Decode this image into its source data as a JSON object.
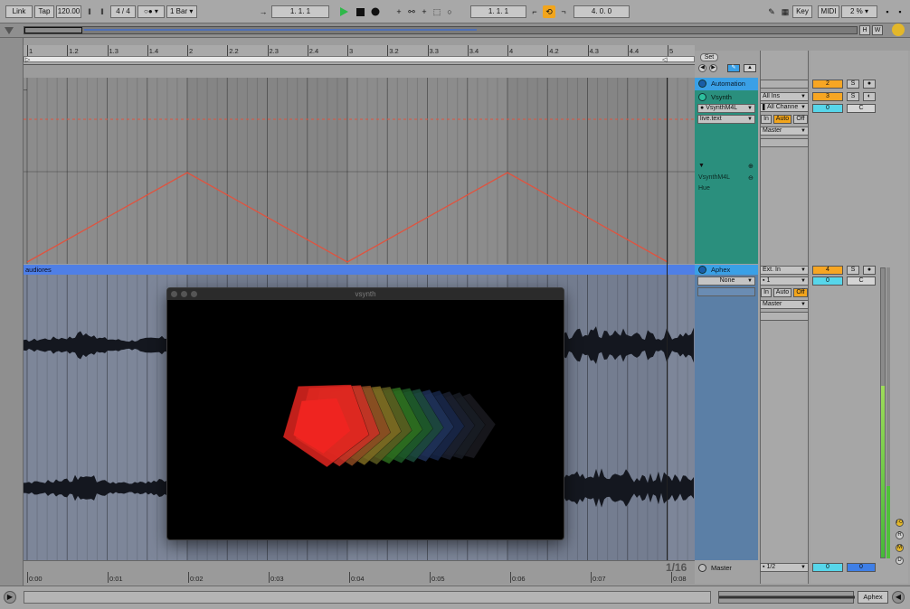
{
  "transport": {
    "link": "Link",
    "tap": "Tap",
    "tempo": "120.00",
    "time_signature": "4 / 4",
    "quantize": "1 Bar",
    "arrangement_position": "1.   1.   1",
    "loop_start": "1.   1.   1",
    "loop_length": "4.   0.   0",
    "key": "Key",
    "midi": "MIDI",
    "cpu": "2 %"
  },
  "overview": {
    "btn_h": "H",
    "btn_w": "W"
  },
  "ruler": {
    "ticks": [
      "1",
      "1.2",
      "1.3",
      "1.4",
      "2",
      "2.2",
      "2.3",
      "2.4",
      "3",
      "3.2",
      "3.3",
      "3.4",
      "4",
      "4.2",
      "4.3",
      "4.4",
      "5"
    ]
  },
  "session_controls": {
    "set_label": "Set"
  },
  "tracks": {
    "automation": {
      "name": "Automation",
      "input": "",
      "number": "2",
      "solo": "S"
    },
    "vsynth": {
      "name": "Vsynth",
      "input_type": "All Ins",
      "input_channel": "All Channe",
      "device": "VsynthM4L",
      "param": "live.text",
      "monitor_in": "In",
      "monitor_auto": "Auto",
      "monitor_off": "Off",
      "output": "Master",
      "number": "3",
      "solo": "S",
      "volume": "0",
      "pan": "C",
      "automation_device": "VsynthM4L",
      "automation_param": "Hue"
    },
    "audio": {
      "clip_name": "audiores",
      "name": "Aphex",
      "device": "None",
      "input_type": "Ext. In",
      "input_channel": "1",
      "monitor_in": "In",
      "monitor_auto": "Auto",
      "monitor_off": "Off",
      "output": "Master",
      "number": "4",
      "solo": "S",
      "volume": "0",
      "pan": "C"
    },
    "master": {
      "name": "Master",
      "output": "1/2",
      "volume": "0",
      "pan": "0"
    }
  },
  "timebar": {
    "zoom": "1/16",
    "times": [
      "0:00",
      "0:01",
      "0:02",
      "0:03",
      "0:04",
      "0:05",
      "0:06",
      "0:07",
      "0:08"
    ]
  },
  "vsynth_window": {
    "title": "vsynth"
  },
  "bottom": {
    "track_label": "Aphex"
  },
  "colors": {
    "automation_accent": "#3aa0e6",
    "vsynth_track": "#2a8f7d",
    "audio_track": "#5b7fa6",
    "clip_header": "#4f7fe6",
    "envelope": "#e0533f",
    "play_green": "#2fb84a",
    "loop_orange": "#f2a51c",
    "track_number_orange": "#f7a623",
    "volume_cyan": "#57d6ea"
  },
  "automation_envelope": {
    "points_bar_pos": [
      [
        1.0,
        0.0
      ],
      [
        2.0,
        1.0
      ],
      [
        3.0,
        0.0
      ],
      [
        4.0,
        1.0
      ],
      [
        5.0,
        0.0
      ]
    ]
  }
}
